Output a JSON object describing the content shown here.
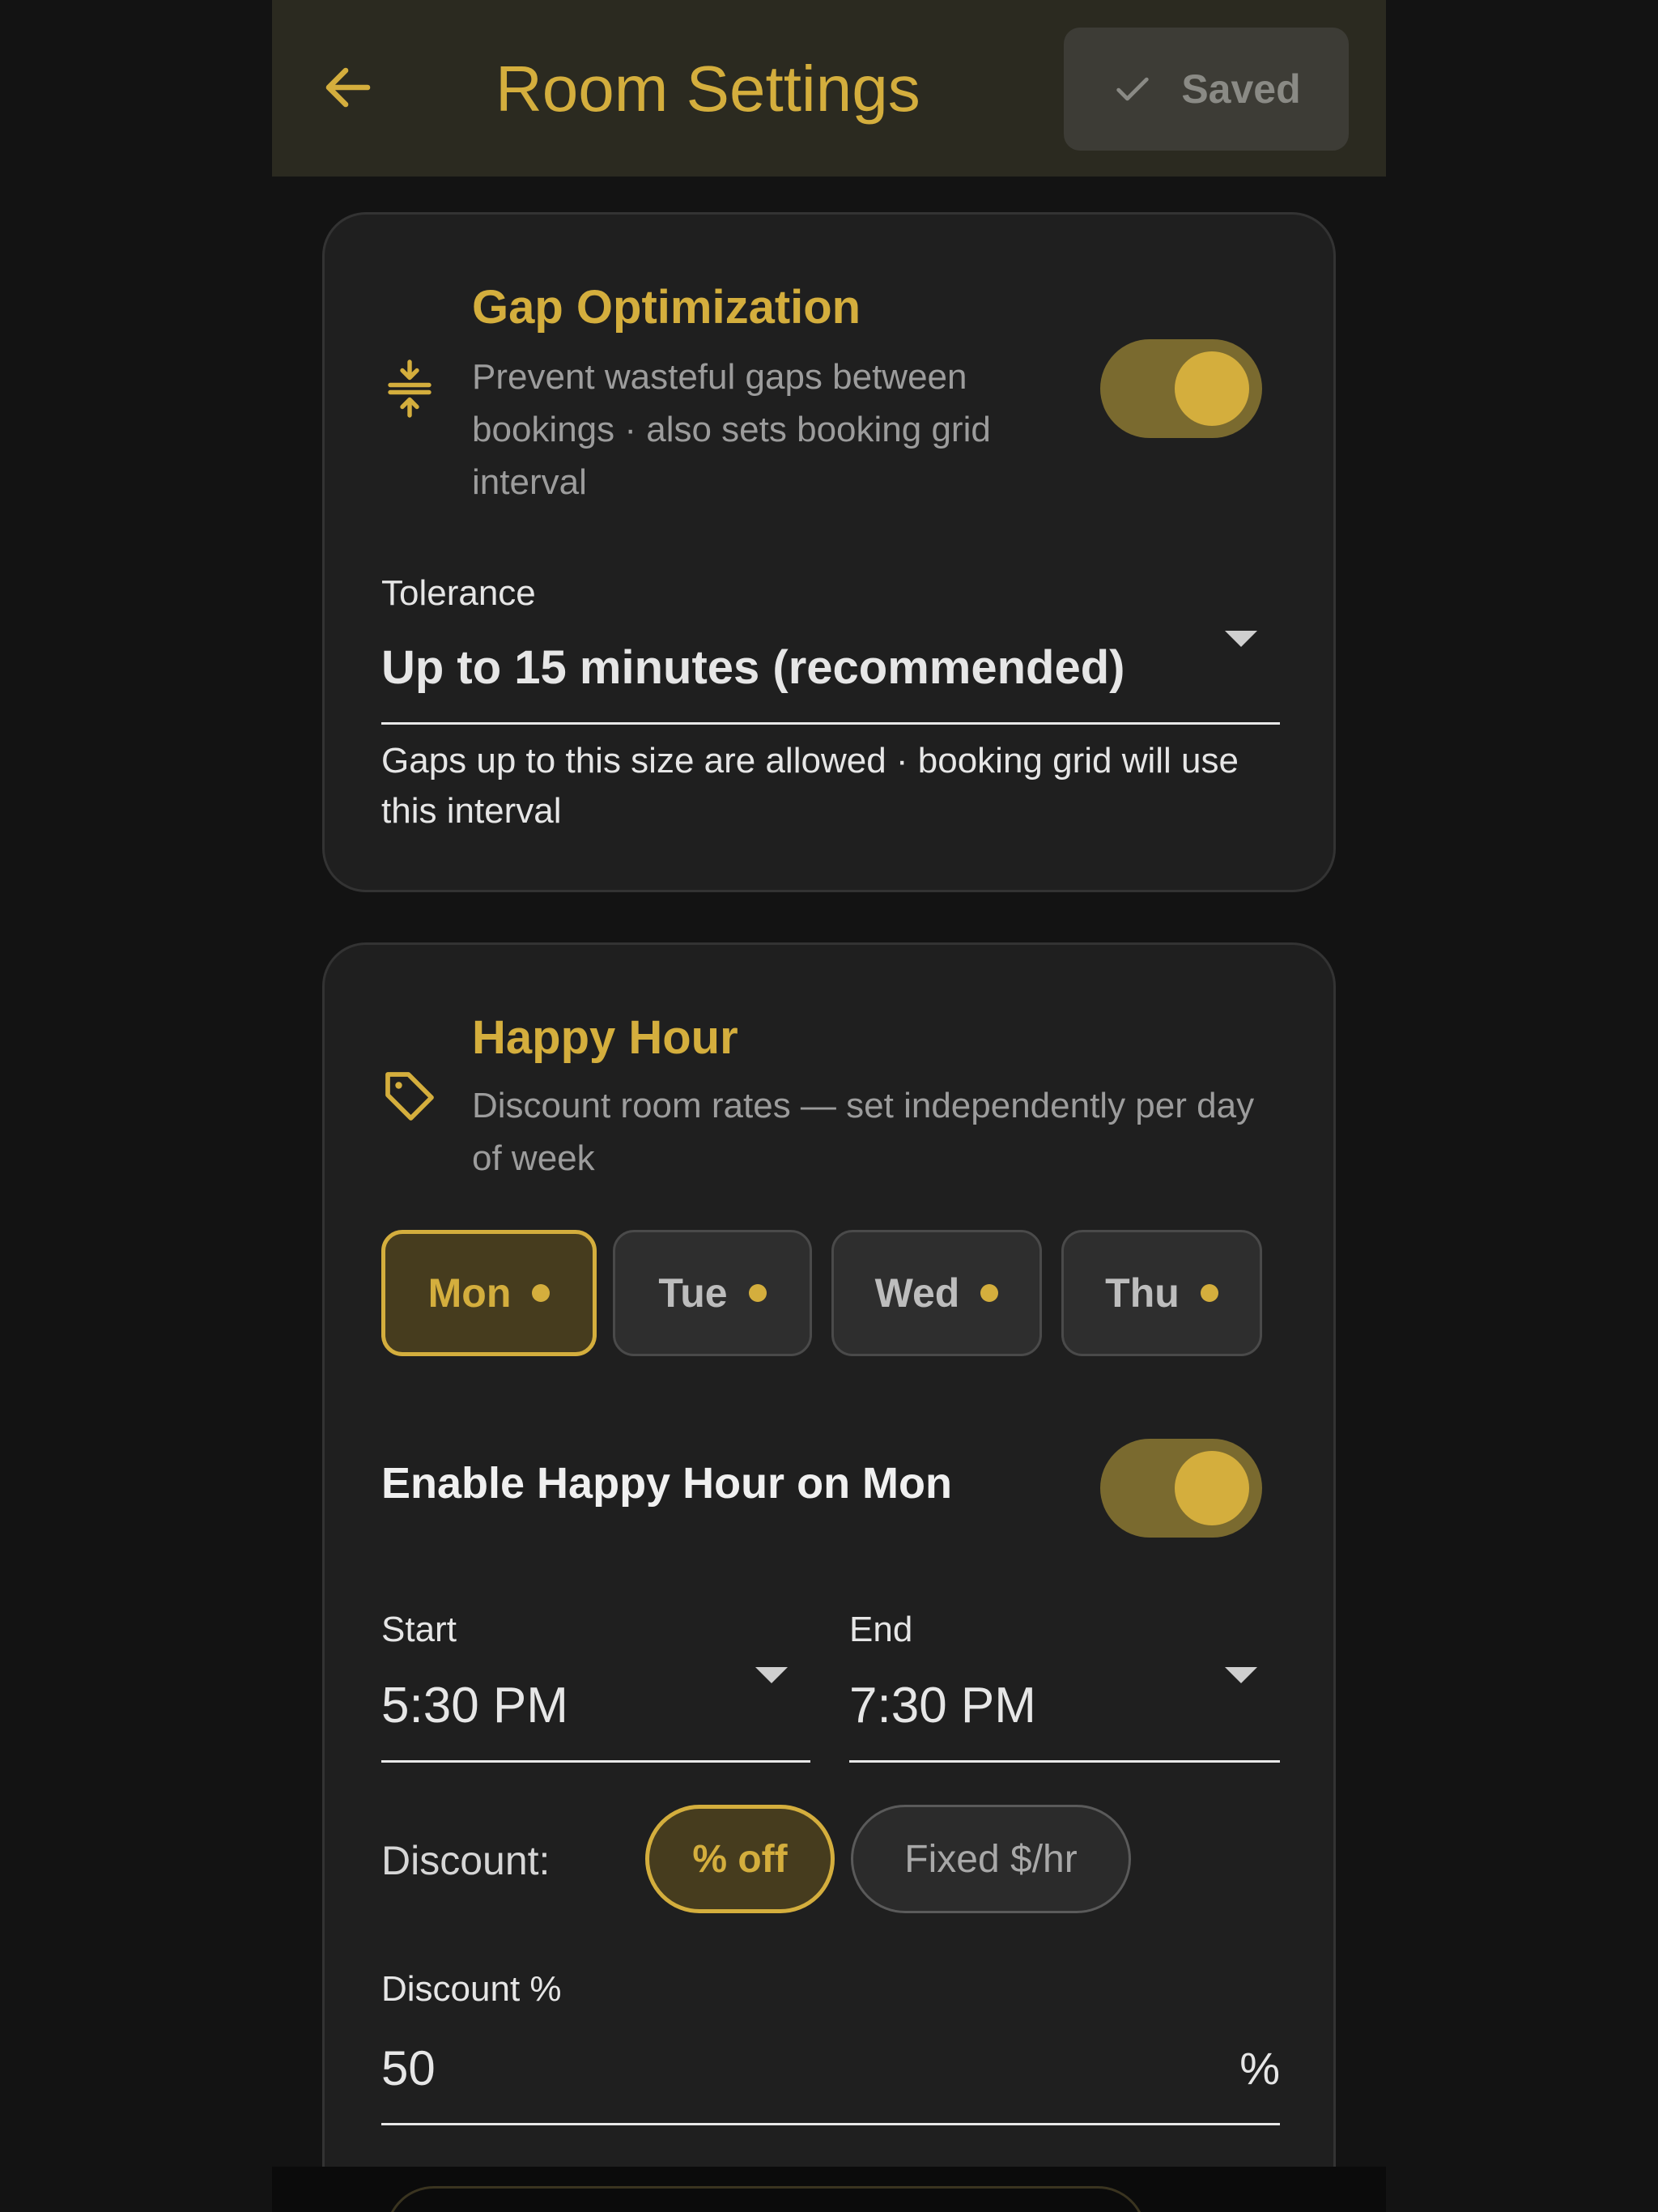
{
  "appbar": {
    "title": "Room Settings",
    "saved_label": "Saved"
  },
  "gap_optimization": {
    "title": "Gap Optimization",
    "description": "Prevent wasteful gaps between bookings · also sets booking grid interval",
    "enabled": true,
    "tolerance_label": "Tolerance",
    "tolerance_value": "Up to 15 minutes (recommended)",
    "helper": "Gaps up to this size are allowed · booking grid will use this interval"
  },
  "happy_hour": {
    "title": "Happy Hour",
    "description": "Discount room rates — set independently per day of week",
    "days": [
      {
        "label": "Mon",
        "active": true
      },
      {
        "label": "Tue",
        "active": false
      },
      {
        "label": "Wed",
        "active": false
      },
      {
        "label": "Thu",
        "active": false
      }
    ],
    "enable_label": "Enable Happy Hour on Mon",
    "enabled": true,
    "start_label": "Start",
    "start_value": "5:30 PM",
    "end_label": "End",
    "end_value": "7:30 PM",
    "discount_label": "Discount:",
    "discount_options": [
      "% off",
      "Fixed $/hr"
    ],
    "discount_selected": "% off",
    "discount_pct_label": "Discount %",
    "discount_pct_value": "50",
    "discount_pct_suffix": "%"
  },
  "colors": {
    "accent": "#d4ae3d",
    "background": "#131313",
    "card": "#1f1f1f",
    "appbar": "#2b2a20"
  }
}
